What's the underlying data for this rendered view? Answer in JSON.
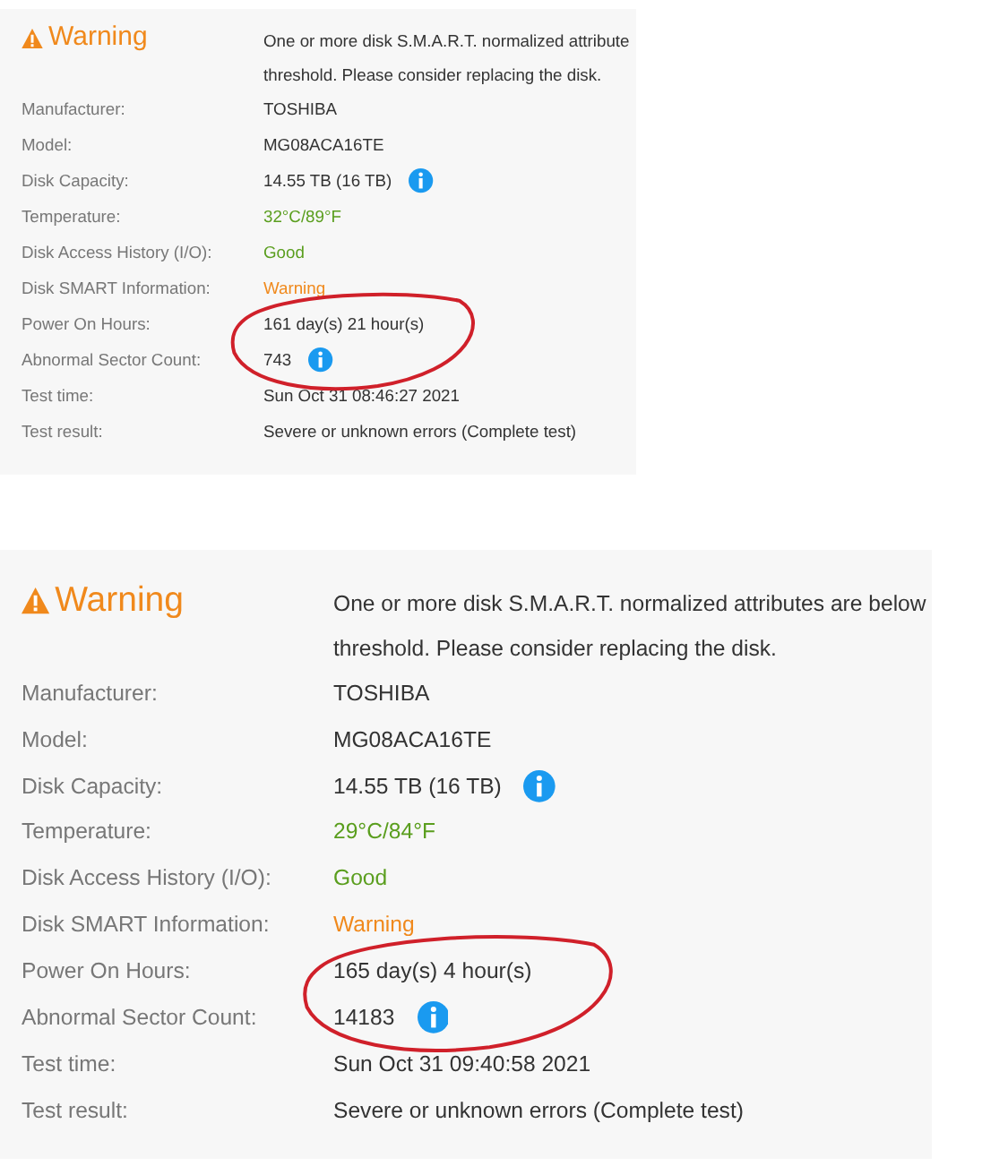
{
  "panels": [
    {
      "title": "Warning",
      "description_lines": [
        "One or more disk S.M.A.R.T. normalized attribute",
        "threshold. Please consider replacing the disk."
      ],
      "rows": [
        {
          "label": "Manufacturer:",
          "value": "TOSHIBA",
          "color": "#333333",
          "info": false,
          "circled": false
        },
        {
          "label": "Model:",
          "value": "MG08ACA16TE",
          "color": "#333333",
          "info": false,
          "circled": false
        },
        {
          "label": "Disk Capacity:",
          "value": "14.55 TB (16 TB)",
          "color": "#333333",
          "info": true,
          "circled": false
        },
        {
          "label": "Temperature:",
          "value": "32°C/89°F",
          "color": "#5a9e1e",
          "info": false,
          "circled": false
        },
        {
          "label": "Disk Access History (I/O):",
          "value": "Good",
          "color": "#5a9e1e",
          "info": false,
          "circled": false
        },
        {
          "label": "Disk SMART Information:",
          "value": "Warning",
          "color": "#f0891c",
          "info": false,
          "circled": false
        },
        {
          "label": "Power On Hours:",
          "value": "161 day(s) 21 hour(s)",
          "color": "#333333",
          "info": false,
          "circled": true
        },
        {
          "label": "Abnormal Sector Count:",
          "value": "743",
          "color": "#333333",
          "info": true,
          "circled": true
        },
        {
          "label": "Test time:",
          "value": "Sun Oct 31 08:46:27 2021",
          "color": "#333333",
          "info": false,
          "circled": false
        },
        {
          "label": "Test result:",
          "value": "Severe or unknown errors (Complete test)",
          "color": "#333333",
          "info": false,
          "circled": false
        }
      ]
    },
    {
      "title": "Warning",
      "description_lines": [
        "One or more disk S.M.A.R.T. normalized attributes are below",
        "threshold. Please consider replacing the disk."
      ],
      "rows": [
        {
          "label": "Manufacturer:",
          "value": "TOSHIBA",
          "color": "#333333",
          "info": false,
          "circled": false
        },
        {
          "label": "Model:",
          "value": "MG08ACA16TE",
          "color": "#333333",
          "info": false,
          "circled": false
        },
        {
          "label": "Disk Capacity:",
          "value": "14.55 TB (16 TB)",
          "color": "#333333",
          "info": true,
          "circled": false
        },
        {
          "label": "Temperature:",
          "value": "29°C/84°F",
          "color": "#5a9e1e",
          "info": false,
          "circled": false
        },
        {
          "label": "Disk Access History (I/O):",
          "value": "Good",
          "color": "#5a9e1e",
          "info": false,
          "circled": false
        },
        {
          "label": "Disk SMART Information:",
          "value": "Warning",
          "color": "#f0891c",
          "info": false,
          "circled": false
        },
        {
          "label": "Power On Hours:",
          "value": "165 day(s) 4 hour(s)",
          "color": "#333333",
          "info": false,
          "circled": true
        },
        {
          "label": "Abnormal Sector Count:",
          "value": "14183",
          "color": "#333333",
          "info": true,
          "circled": true
        },
        {
          "label": "Test time:",
          "value": "Sun Oct 31 09:40:58 2021",
          "color": "#333333",
          "info": false,
          "circled": false
        },
        {
          "label": "Test result:",
          "value": "Severe or unknown errors (Complete test)",
          "color": "#333333",
          "info": false,
          "circled": false
        }
      ]
    }
  ]
}
